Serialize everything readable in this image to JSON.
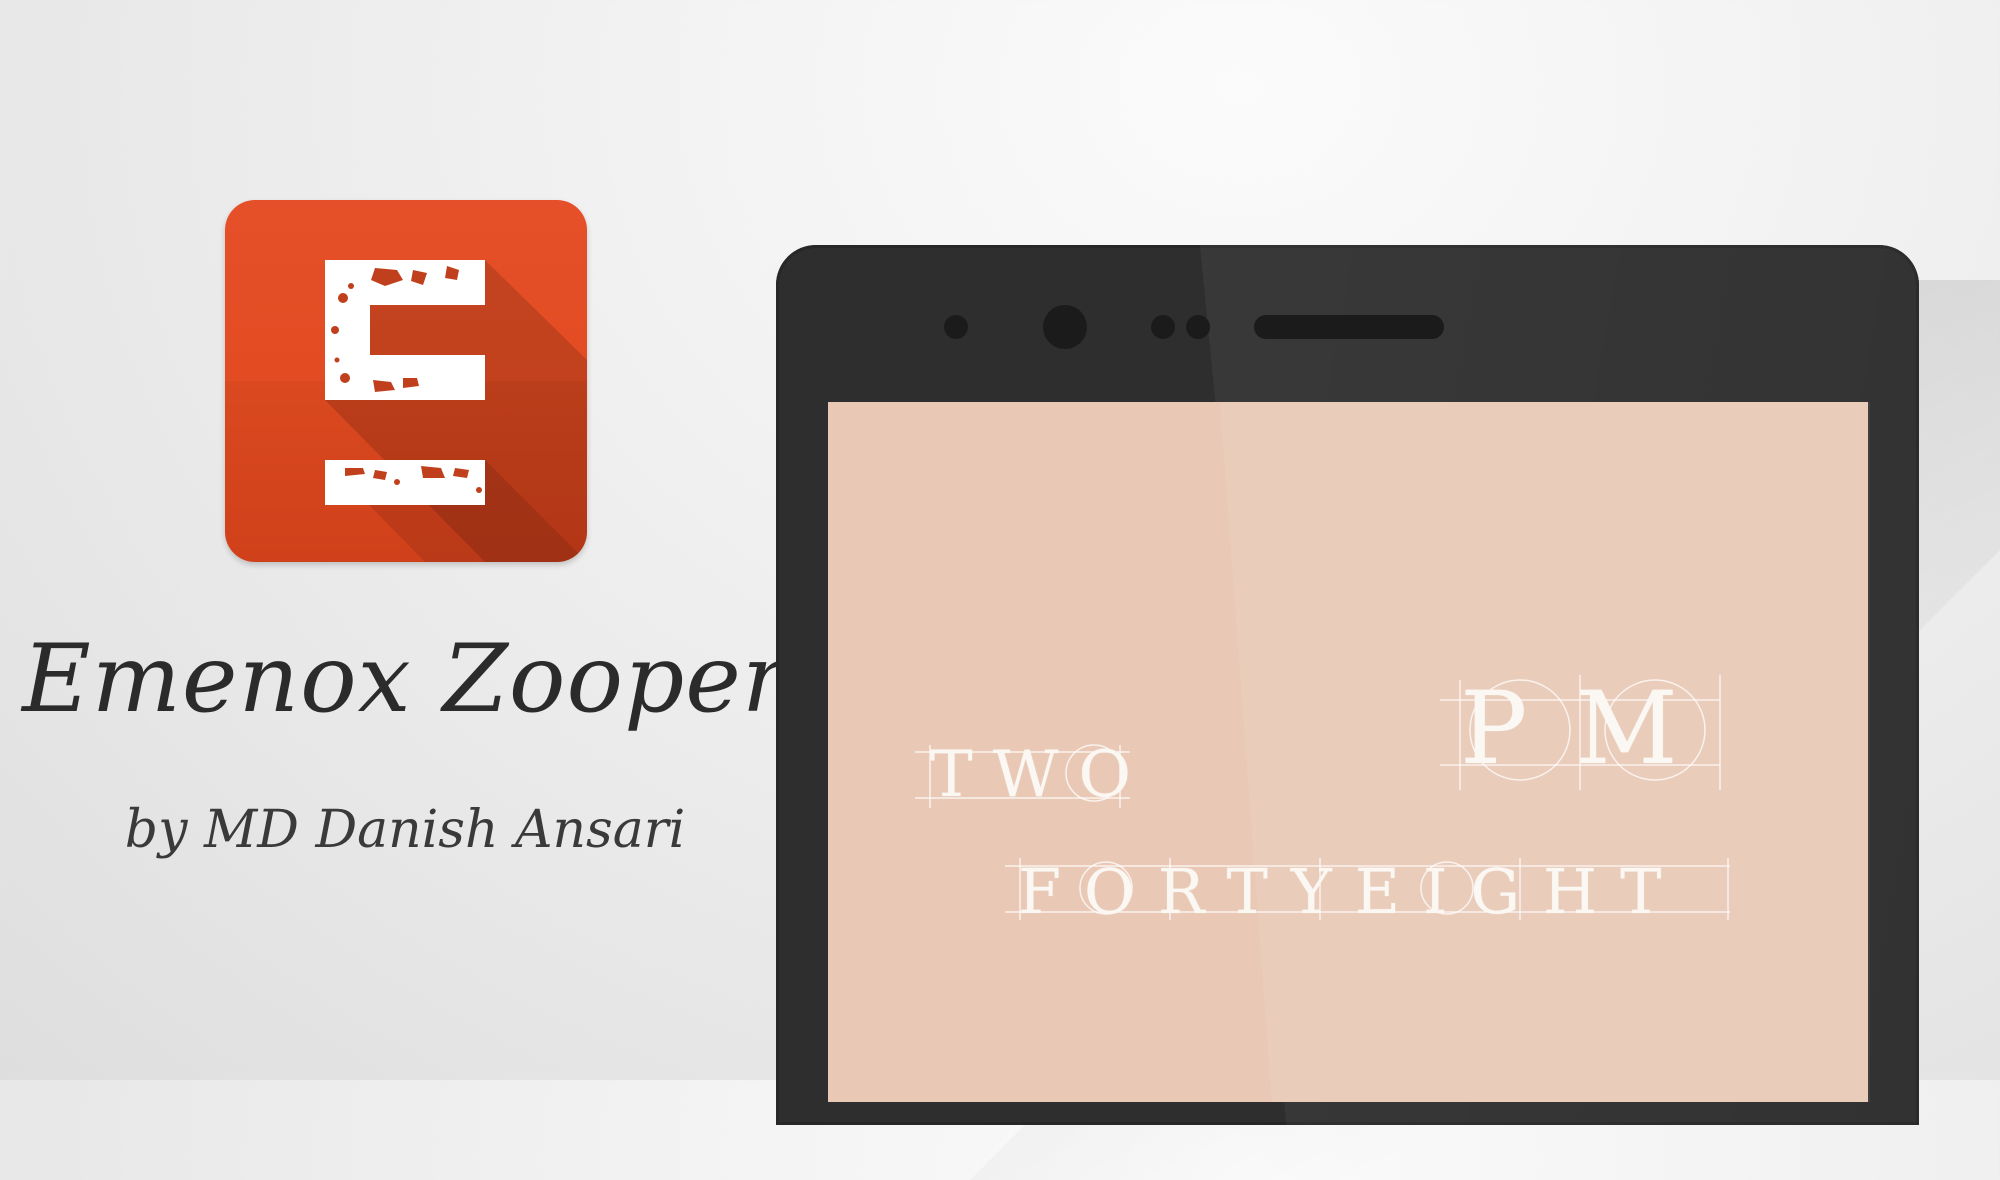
{
  "promo": {
    "app_title": "Emenox Zooper",
    "author": "by MD Danish Ansari"
  },
  "icon": {
    "name": "letter-e-icon",
    "background_color": "#e34c22",
    "glyph_color": "#ffffff"
  },
  "phone": {
    "screen_color": "#e9c9b6",
    "bezel_color": "#2e2e2e"
  },
  "clock": {
    "hour": "TWO",
    "ampm": "PM",
    "minute": "FORTYEIGHT"
  }
}
